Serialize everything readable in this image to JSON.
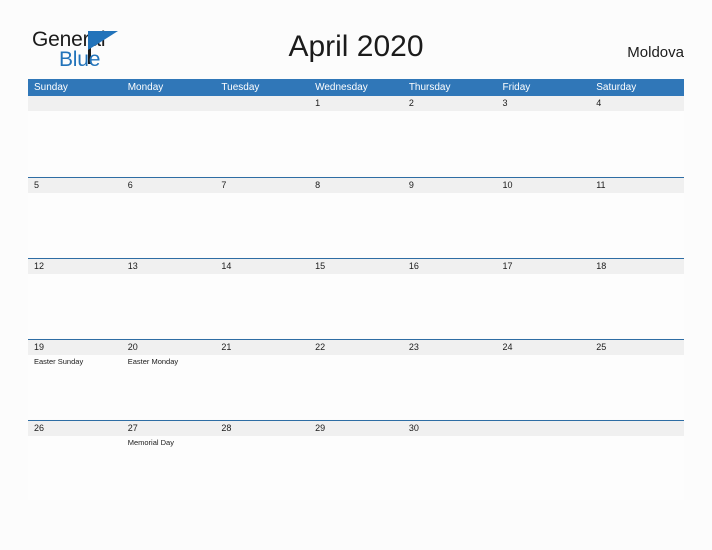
{
  "brand": {
    "name_part1": "General",
    "name_part2": "Blue",
    "triangle_color": "#2273ba"
  },
  "header": {
    "title": "April 2020",
    "country": "Moldova"
  },
  "colors": {
    "header_blue": "#3077b8",
    "row_line": "#2e6da4",
    "date_band": "#f0f0f0",
    "page_background": "#fcfcfc"
  },
  "calendar": {
    "weekdays": [
      "Sunday",
      "Monday",
      "Tuesday",
      "Wednesday",
      "Thursday",
      "Friday",
      "Saturday"
    ],
    "weeks": [
      {
        "days": [
          {
            "date": "",
            "event": ""
          },
          {
            "date": "",
            "event": ""
          },
          {
            "date": "",
            "event": ""
          },
          {
            "date": "1",
            "event": ""
          },
          {
            "date": "2",
            "event": ""
          },
          {
            "date": "3",
            "event": ""
          },
          {
            "date": "4",
            "event": ""
          }
        ]
      },
      {
        "days": [
          {
            "date": "5",
            "event": ""
          },
          {
            "date": "6",
            "event": ""
          },
          {
            "date": "7",
            "event": ""
          },
          {
            "date": "8",
            "event": ""
          },
          {
            "date": "9",
            "event": ""
          },
          {
            "date": "10",
            "event": ""
          },
          {
            "date": "11",
            "event": ""
          }
        ]
      },
      {
        "days": [
          {
            "date": "12",
            "event": ""
          },
          {
            "date": "13",
            "event": ""
          },
          {
            "date": "14",
            "event": ""
          },
          {
            "date": "15",
            "event": ""
          },
          {
            "date": "16",
            "event": ""
          },
          {
            "date": "17",
            "event": ""
          },
          {
            "date": "18",
            "event": ""
          }
        ]
      },
      {
        "days": [
          {
            "date": "19",
            "event": "Easter Sunday"
          },
          {
            "date": "20",
            "event": "Easter Monday"
          },
          {
            "date": "21",
            "event": ""
          },
          {
            "date": "22",
            "event": ""
          },
          {
            "date": "23",
            "event": ""
          },
          {
            "date": "24",
            "event": ""
          },
          {
            "date": "25",
            "event": ""
          }
        ]
      },
      {
        "days": [
          {
            "date": "26",
            "event": ""
          },
          {
            "date": "27",
            "event": "Memorial Day"
          },
          {
            "date": "28",
            "event": ""
          },
          {
            "date": "29",
            "event": ""
          },
          {
            "date": "30",
            "event": ""
          },
          {
            "date": "",
            "event": ""
          },
          {
            "date": "",
            "event": ""
          }
        ]
      }
    ]
  }
}
